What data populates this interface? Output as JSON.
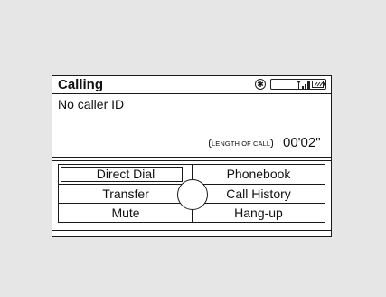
{
  "header": {
    "title": "Calling",
    "bluetooth_icon": "bluetooth-icon",
    "signal_icon": "signal-strength-icon",
    "battery_icon": "battery-icon"
  },
  "call": {
    "caller": "No caller ID",
    "length_label": "LENGTH OF CALL",
    "length_value": "00'02\""
  },
  "menu": {
    "direct_dial": "Direct Dial",
    "phonebook": "Phonebook",
    "transfer": "Transfer",
    "call_history": "Call History",
    "mute": "Mute",
    "hang_up": "Hang-up"
  }
}
